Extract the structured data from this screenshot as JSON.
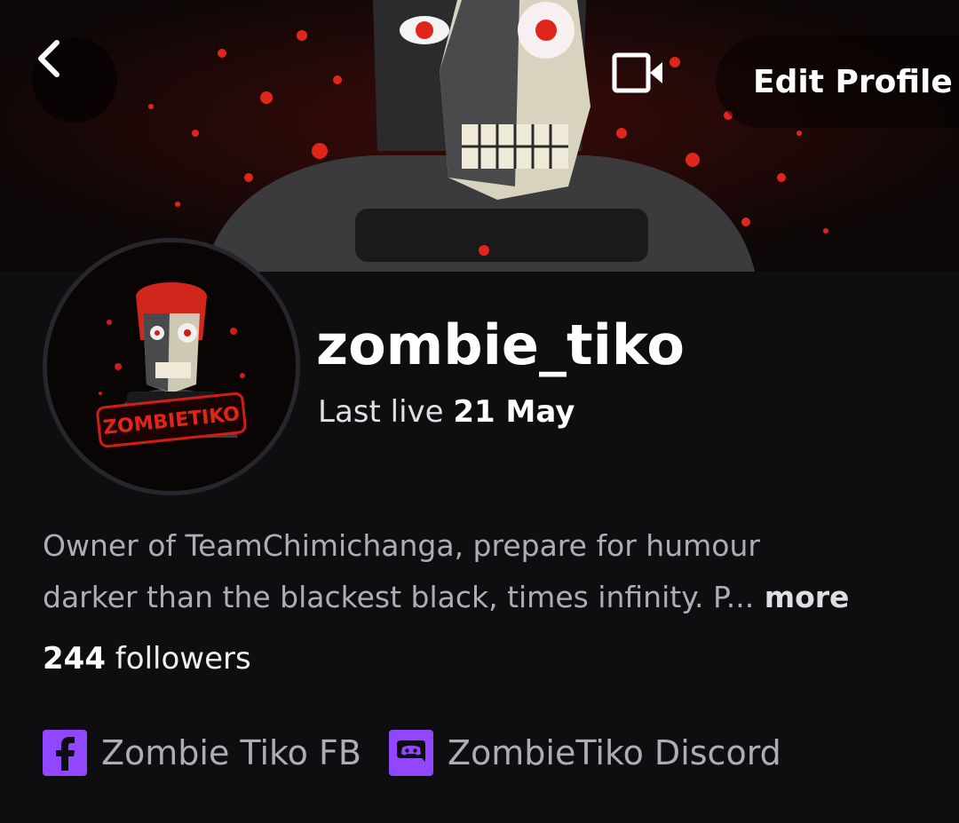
{
  "header": {
    "back_icon": "chevron-left-icon",
    "video_icon": "video-camera-icon",
    "edit_profile_label": "Edit Profile"
  },
  "profile": {
    "username": "zombie_tiko",
    "avatar_text": "ZOMBIETIKO",
    "last_live_prefix": "Last live",
    "last_live_date": "21 May",
    "bio_line1": "Owner of TeamChimichanga, prepare for humour",
    "bio_line2": "darker than the blackest black, times infinity. P...",
    "more_label": " more",
    "followers_count": "244",
    "followers_label": "followers"
  },
  "social_links": [
    {
      "icon": "facebook-icon",
      "label": "Zombie Tiko FB"
    },
    {
      "icon": "discord-icon",
      "label": "ZombieTiko Discord"
    }
  ],
  "colors": {
    "background": "#0e0e10",
    "accent": "#9147ff",
    "banner_red": "#e0261b"
  }
}
